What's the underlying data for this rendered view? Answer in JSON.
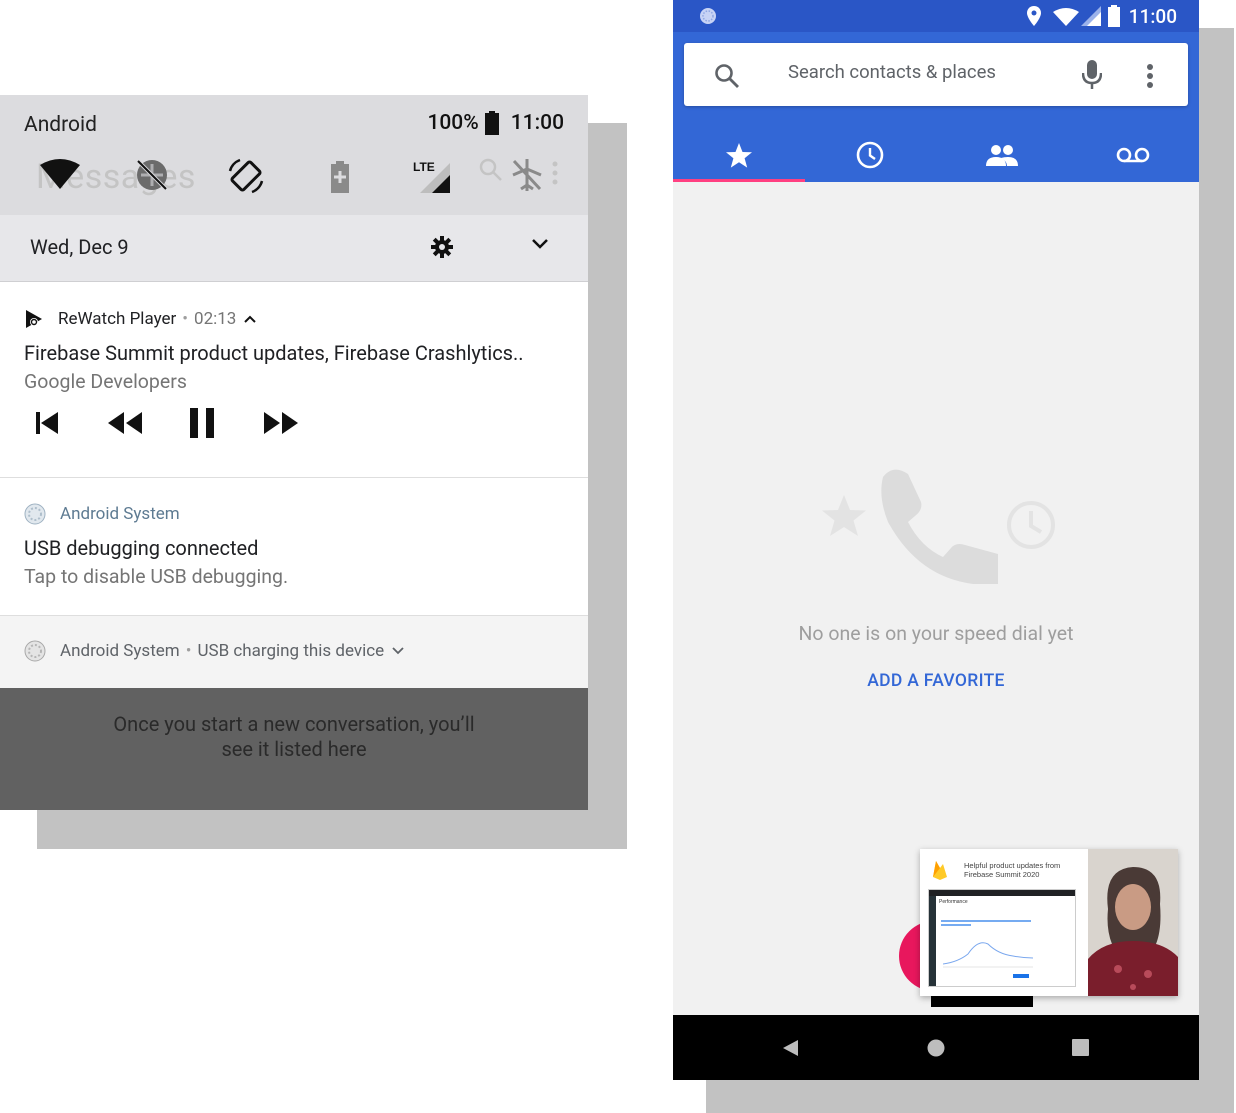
{
  "notification_shade": {
    "background_app_title": "Messages",
    "carrier": "Android",
    "battery_percent": "100%",
    "time": "11:00",
    "date": "Wed, Dec 9",
    "quick_tiles": [
      "wifi-icon",
      "data-saver-off-icon",
      "auto-rotate-icon",
      "battery-saver-icon",
      "mobile-data-lte-icon",
      "airplane-mode-off-icon"
    ],
    "media_notification": {
      "app": "ReWatch Player",
      "elapsed": "02:13",
      "title": "Firebase Summit product updates, Firebase Crashlytics..",
      "subtitle": "Google Developers",
      "controls": [
        "skip-previous-icon",
        "rewind-icon",
        "pause-icon",
        "fast-forward-icon"
      ]
    },
    "usb_debug_notification": {
      "app": "Android System",
      "title": "USB debugging connected",
      "text": "Tap to disable USB debugging."
    },
    "usb_charging_notification": {
      "app": "Android System",
      "text": "USB charging this device"
    },
    "background_empty_text": "Once you start a new conversation, you’ll see it listed here"
  },
  "phone_app": {
    "status_time": "11:00",
    "search_placeholder": "Search contacts & places",
    "tabs": [
      {
        "name": "speed-dial",
        "icon": "star-icon",
        "selected": true
      },
      {
        "name": "recents",
        "icon": "clock-icon",
        "selected": false
      },
      {
        "name": "contacts",
        "icon": "people-icon",
        "selected": false
      },
      {
        "name": "voicemail",
        "icon": "voicemail-icon",
        "selected": false
      }
    ],
    "empty_message": "No one is on your speed dial yet",
    "add_favorite": "ADD A FAVORITE",
    "pip_video_title": "Helpful product updates from Firebase Summit 2020",
    "pip_dashboard_heading": "Performance"
  },
  "colors": {
    "header_blue": "#3367d6",
    "status_blue": "#2a56c6",
    "tab_indicator": "#ff4081",
    "fab": "#e8175d",
    "link_blue": "#3367d6"
  }
}
